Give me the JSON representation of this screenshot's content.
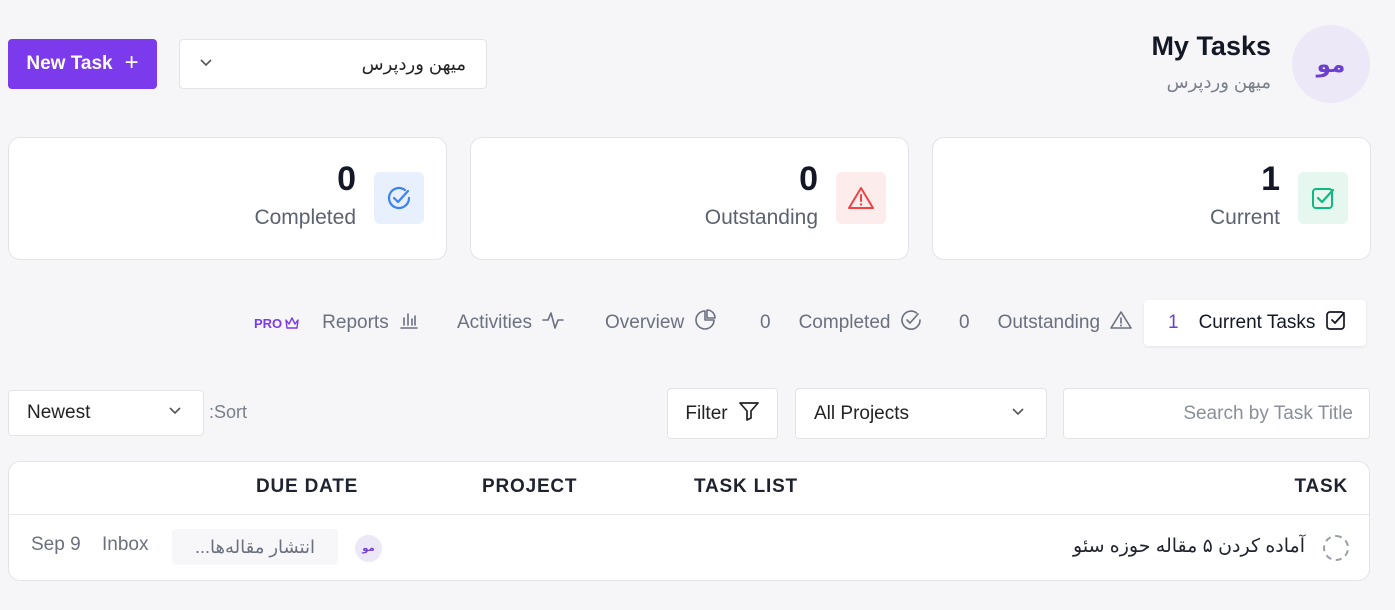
{
  "header": {
    "new_task_label": "New Task",
    "workspace_value": "میهن وردپرس",
    "title": "My Tasks",
    "subtitle": "میهن وردپرس",
    "avatar_initials": "مو"
  },
  "stats": {
    "completed": {
      "value": "0",
      "label": "Completed",
      "color": "#3b82f6"
    },
    "outstanding": {
      "value": "0",
      "label": "Outstanding",
      "color": "#ef4444"
    },
    "current": {
      "value": "1",
      "label": "Current",
      "color": "#10b981"
    }
  },
  "tabs": {
    "reports": {
      "label": "Reports",
      "badge": "PRO"
    },
    "activities": {
      "label": "Activities"
    },
    "overview": {
      "label": "Overview"
    },
    "completed": {
      "label": "Completed",
      "count": "0"
    },
    "outstanding": {
      "label": "Outstanding",
      "count": "0"
    },
    "current": {
      "label": "Current Tasks",
      "count": "1"
    }
  },
  "filters": {
    "sort_value": "Newest",
    "sort_label": "Sort:",
    "filter_label": "Filter",
    "project_value": "All Projects",
    "search_placeholder": "Search by Task Title"
  },
  "table": {
    "headers": {
      "due_date": "DUE DATE",
      "project": "PROJECT",
      "task_list": "TASK LIST",
      "task": "TASK"
    },
    "rows": [
      {
        "due_date": "Sep 9",
        "project": "Inbox",
        "task_list": "انتشار مقاله‌ها...",
        "assignee": "مو",
        "task": "آماده کردن ۵ مقاله حوزه سئو"
      }
    ]
  },
  "accent_color": "#7c3aed"
}
